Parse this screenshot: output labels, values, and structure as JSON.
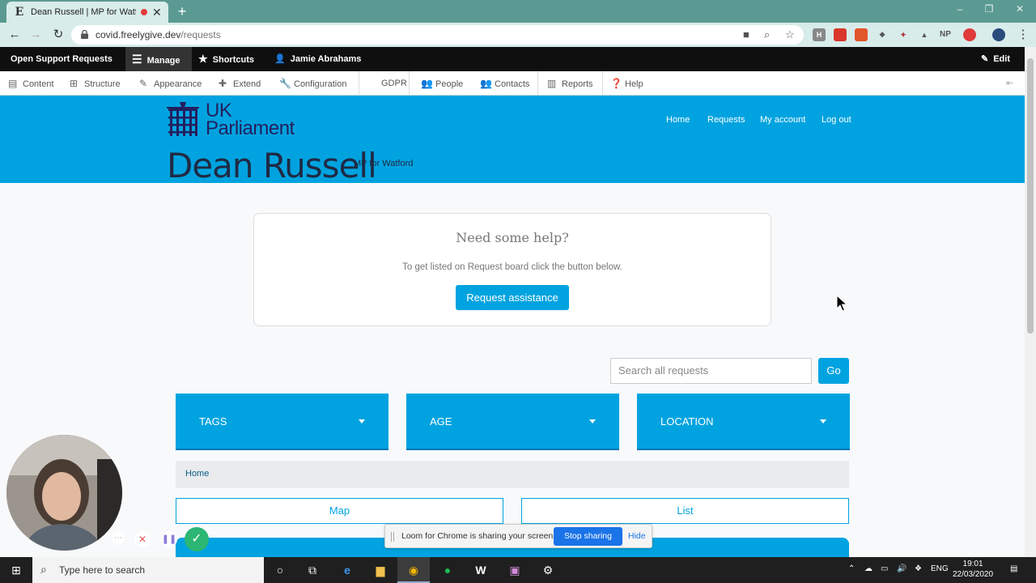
{
  "browser": {
    "tab_title": "Dean Russell | MP for Watford",
    "tab_favicon": "E",
    "url_host": "covid.freelygive.dev",
    "url_path": "/requests",
    "window_controls": [
      "–",
      "❐",
      "✕"
    ],
    "extensions": [
      "H",
      "NP"
    ]
  },
  "admin_toolbar": {
    "items": [
      "Open Support Requests",
      "Manage",
      "Shortcuts",
      "Jamie Abrahams"
    ],
    "edit_label": "Edit"
  },
  "admin_menu": {
    "items": [
      "Content",
      "Structure",
      "Appearance",
      "Extend",
      "Configuration",
      "GDPR",
      "People",
      "Contacts",
      "Reports",
      "Help"
    ]
  },
  "site_header": {
    "logo_line1": "UK",
    "logo_line2": "Parliament",
    "mp_name": "Dean Russell",
    "mp_constituency": "MP for Watford",
    "nav": [
      "Home",
      "Requests",
      "My account",
      "Log out"
    ]
  },
  "help_box": {
    "heading": "Need some help?",
    "text": "To get listed on Request board click the button below.",
    "button": "Request assistance"
  },
  "search": {
    "placeholder": "Search all requests",
    "go_label": "Go"
  },
  "filters": [
    "TAGS",
    "AGE",
    "LOCATION"
  ],
  "breadcrumb": "Home",
  "view_tabs": [
    "Map",
    "List"
  ],
  "loom": {
    "message": "Loom for Chrome is sharing your screen.",
    "stop_label": "Stop sharing",
    "hide_label": "Hide"
  },
  "taskbar": {
    "search_placeholder": "Type here to search",
    "language": "ENG",
    "time": "19:01",
    "date": "22/03/2020"
  },
  "colors": {
    "brand_blue": "#00a3e0",
    "toolbar_black": "#0f0f0f",
    "chrome_teal": "#5b9a92",
    "parliament_navy": "#231f5e"
  }
}
